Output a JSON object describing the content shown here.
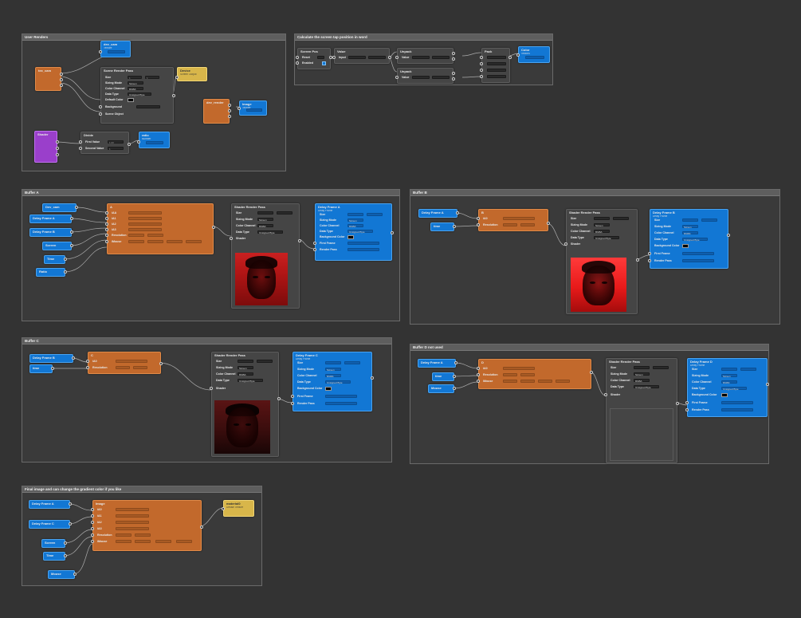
{
  "groups": {
    "user_renders": "User Renders",
    "screen_tap": "Calculate the screen tap position in word",
    "buffer_a": "Buffer A",
    "buffer_b": "Buffer B",
    "buffer_c": "Buffer C",
    "buffer_d": "Buffer D not used",
    "final": "Final image and can change the gradient color if you like"
  },
  "ur": {
    "dev_cam_title": "dev_cam",
    "dev_cam_sub": "Texture",
    "tex_cam": "tex_cam",
    "srp_title": "Scene Render Pass",
    "size": "Size",
    "size_v1": "1",
    "size_v2": "1",
    "sizing_mode": "Sizing Mode",
    "sizing_val": "Screen",
    "color_channel": "Color Channel",
    "color_val": "RGBA",
    "data_type": "Data Type",
    "data_val": "Unsigned Byte",
    "default_color": "Default Color",
    "background": "Background",
    "scene_object": "Scene Object",
    "device": "Device",
    "screen_output": "Screen Output",
    "dev_render": "dev_render",
    "render_title": "Image",
    "render_sub": "Texture",
    "shader": "Shader",
    "divide": "Divide",
    "first_value": "First Value",
    "first_val": "1.00",
    "second_value": "Second Value",
    "second_val": "1",
    "ratio_title": "ratio",
    "ratio_sub": "Number"
  },
  "st": {
    "screen_pos": "Screen Pos",
    "reset": "Reset",
    "enabled": "Enabled",
    "value": "Value",
    "input": "Input",
    "unpack": "Unpack",
    "unpack2": "Unpack",
    "unpack_value": "Value",
    "unpack_value2": "Value",
    "pack": "Pack",
    "out_title": "Color",
    "out_sub": "Vector4"
  },
  "a": {
    "dev_cam": "Dev_cam",
    "delay_a": "Delay Frame A",
    "delay_b": "Delay Frame B",
    "screen": "Screen",
    "time": "Time",
    "ratio": "Ratio",
    "patch": "A",
    "rows": [
      "iAA",
      "iA1",
      "iA2",
      "iA3",
      "Resolution",
      "iMouse"
    ],
    "srp_title": "Shader Render Pass",
    "size": "Size",
    "sizing_mode": "Sizing Mode",
    "sizing_val": "Screen",
    "color_channel": "Color Channel",
    "color_val": "RGBA",
    "data_type": "Data Type",
    "data_val": "Unsigned Byte",
    "shader": "Shader",
    "df_title": "Delay Frame A",
    "df_sub": "Delay Frame",
    "df_size": "Size",
    "df_sizing": "Sizing Mode",
    "df_sizing_val": "Screen",
    "df_color": "Color Channel",
    "df_color_val": "RGBA",
    "df_data": "Data Type",
    "df_data_val": "Unsigned Byte",
    "df_bg": "Background Color",
    "df_first": "First Frame",
    "df_render": "Render Pass"
  },
  "b": {
    "delay_a": "Delay Frame A",
    "time": "time",
    "patch": "B",
    "rows": [
      "iA0",
      "Resolution"
    ],
    "srp_title": "Shader Render Pass",
    "size": "Size",
    "sizing_mode": "Sizing Mode",
    "sizing_val": "Screen",
    "color_channel": "Color Channel",
    "color_val": "RGBA",
    "data_type": "Data Type",
    "data_val": "Unsigned Byte",
    "shader": "Shader",
    "df_title": "Delay Frame B",
    "df_sub": "Delay Frame",
    "df_size": "Size",
    "df_sizing": "Sizing Mode",
    "df_sizing_val": "Screen",
    "df_color": "Color Channel",
    "df_color_val": "RGBA",
    "df_data": "Data Type",
    "df_data_val": "Unsigned Byte",
    "df_bg": "Background Color",
    "df_first": "First Frame",
    "df_render": "Render Pass"
  },
  "c": {
    "delay_b": "Delay Frame B",
    "time": "time",
    "patch": "C",
    "rows": [
      "iA0",
      "Resolution"
    ],
    "srp_title": "Shader Render Pass",
    "size": "Size",
    "sizing_mode": "Sizing Mode",
    "sizing_val": "Screen",
    "color_channel": "Color Channel",
    "color_val": "RGBA",
    "data_type": "Data Type",
    "data_val": "Unsigned Byte",
    "shader": "Shader",
    "df_title": "Delay Frame C",
    "df_sub": "Delay Frame",
    "df_size": "Size",
    "df_sizing": "Sizing Mode",
    "df_sizing_val": "Screen",
    "df_color": "Color Channel",
    "df_color_val": "RGBA",
    "df_data": "Data Type",
    "df_data_val": "Unsigned Byte",
    "df_bg": "Background Color",
    "df_first": "First Frame",
    "df_render": "Render Pass"
  },
  "d": {
    "delay_a": "Delay Frame A",
    "time": "time",
    "mouse": "Mouse",
    "patch": "D",
    "rows": [
      "iA0",
      "Resolution",
      "iMouse"
    ],
    "srp_title": "Shader Render Pass",
    "size": "Size",
    "sizing_mode": "Sizing Mode",
    "sizing_val": "Screen",
    "color_channel": "Color Channel",
    "color_val": "RGBA",
    "data_type": "Data Type",
    "data_val": "Unsigned Byte",
    "shader": "Shader",
    "df_title": "Delay Frame D",
    "df_sub": "Delay Frame",
    "df_size": "Size",
    "df_sizing": "Sizing Mode",
    "df_sizing_val": "Screen",
    "df_color": "Color Channel",
    "df_color_val": "RGBA",
    "df_data": "Data Type",
    "df_data_val": "Unsigned Byte",
    "df_bg": "Background Color",
    "df_first": "First Frame",
    "df_render": "Render Pass"
  },
  "f": {
    "delay_a": "Delay Frame A",
    "delay_c": "Delay Frame C",
    "screen": "Screen",
    "time": "Time",
    "mouse": "Mouse",
    "patch": "Image",
    "rows": [
      "iA0",
      "iA1",
      "iA2",
      "iA3",
      "Resolution",
      "iMouse"
    ],
    "mat_title": "material0",
    "mat_sub": "Diffuse Texture"
  },
  "colors": {
    "background": "#333333",
    "node_blue": "#1277d4",
    "node_orange": "#c2692c",
    "node_purple": "#9a3fcb",
    "node_yellow": "#d8b64a",
    "node_gray": "#454545"
  }
}
